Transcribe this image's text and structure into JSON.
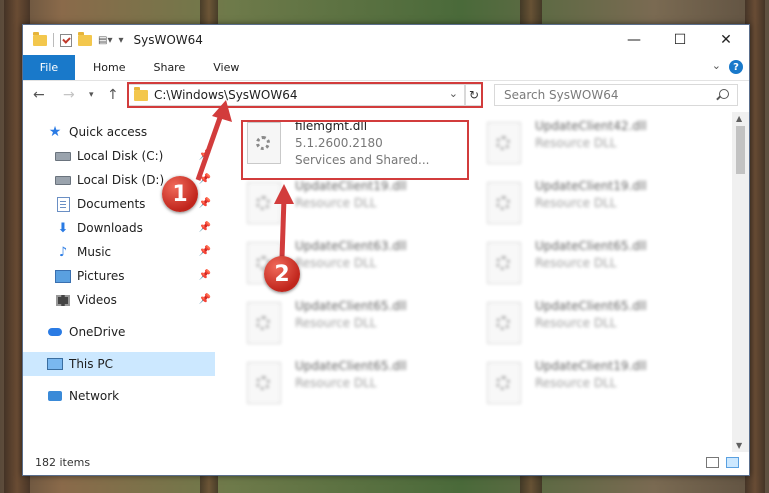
{
  "window": {
    "title": "SysWOW64"
  },
  "ribbon": {
    "file": "File",
    "tabs": [
      "Home",
      "Share",
      "View"
    ],
    "help": "?"
  },
  "address": {
    "path": "C:\\Windows\\SysWOW64",
    "search_placeholder": "Search SysWOW64"
  },
  "sidebar": {
    "items": [
      {
        "label": "Quick access"
      },
      {
        "label": "Local Disk (C:)"
      },
      {
        "label": "Local Disk (D:)"
      },
      {
        "label": "Documents"
      },
      {
        "label": "Downloads"
      },
      {
        "label": "Music"
      },
      {
        "label": "Pictures"
      },
      {
        "label": "Videos"
      },
      {
        "label": "OneDrive"
      },
      {
        "label": "This PC"
      },
      {
        "label": "Network"
      }
    ]
  },
  "files": {
    "highlighted": {
      "name": "filemgmt.dll",
      "version": "5.1.2600.2180",
      "desc": "Services and Shared..."
    },
    "blurred": [
      {
        "name": "UpdateClient42.dll",
        "desc": "Resource DLL"
      },
      {
        "name": "UpdateClient19.dll",
        "desc": "Resource DLL"
      },
      {
        "name": "UpdateClient19.dll",
        "desc": "Resource DLL"
      },
      {
        "name": "UpdateClient63.dll",
        "desc": "Resource DLL"
      },
      {
        "name": "UpdateClient65.dll",
        "desc": "Resource DLL"
      },
      {
        "name": "UpdateClient65.dll",
        "desc": "Resource DLL"
      },
      {
        "name": "UpdateClient65.dll",
        "desc": "Resource DLL"
      },
      {
        "name": "UpdateClient65.dll",
        "desc": "Resource DLL"
      },
      {
        "name": "UpdateClient19.dll",
        "desc": "Resource DLL"
      }
    ]
  },
  "status": {
    "count": "182 items"
  },
  "annotations": {
    "badge1": "1",
    "badge2": "2",
    "color": "#d23c3c"
  }
}
